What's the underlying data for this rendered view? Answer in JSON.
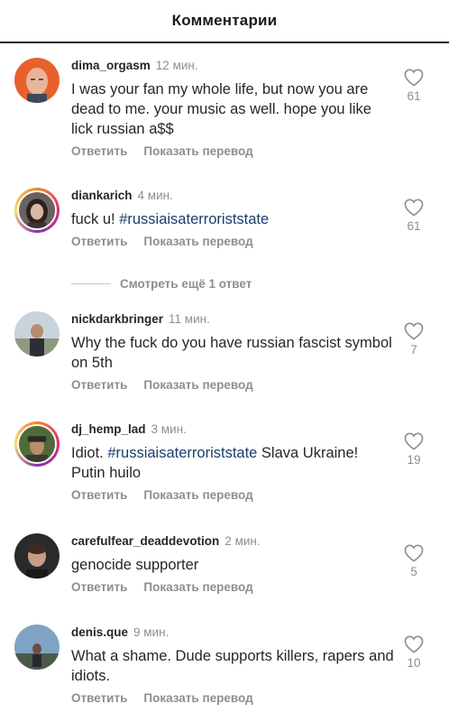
{
  "header": {
    "title": "Комментарии"
  },
  "actions": {
    "reply": "Ответить",
    "translate": "Показать перевод"
  },
  "more_replies": "Смотреть ещё 1 ответ",
  "comments": [
    {
      "username": "dima_orgasm",
      "time": "12 мин.",
      "text": "I was your fan my whole life, but now you are dead to me. your music as well. hope you like lick russian a$$",
      "likes": "61",
      "avatar": "avatar-orange-bald"
    },
    {
      "username": "diankarich",
      "time": "4 мин.",
      "text_before": "fuck u! ",
      "hashtag": "#russiaisaterroriststate",
      "text_after": "",
      "likes": "61",
      "avatar": "avatar-woman-story-ring"
    },
    {
      "username": "nickdarkbringer",
      "time": "11 мин.",
      "text": "Why the fuck do you have russian fascist symbol on 5th",
      "likes": "7",
      "avatar": "avatar-man-outdoor"
    },
    {
      "username": "dj_hemp_lad",
      "time": "3 мин.",
      "text_before": "Idiot. ",
      "hashtag": "#russiaisaterroriststate",
      "text_after": " Slava Ukraine! Putin huilo",
      "likes": "19",
      "avatar": "avatar-man-cap-story-ring"
    },
    {
      "username": "carefulfear_deaddevotion",
      "time": "2 мин.",
      "text": "genocide supporter",
      "likes": "5",
      "avatar": "avatar-man-dark"
    },
    {
      "username": "denis.que",
      "time": "9 мин.",
      "text": "What a shame. Dude supports killers, rapers and idiots.",
      "likes": "10",
      "avatar": "avatar-man-landscape"
    }
  ]
}
